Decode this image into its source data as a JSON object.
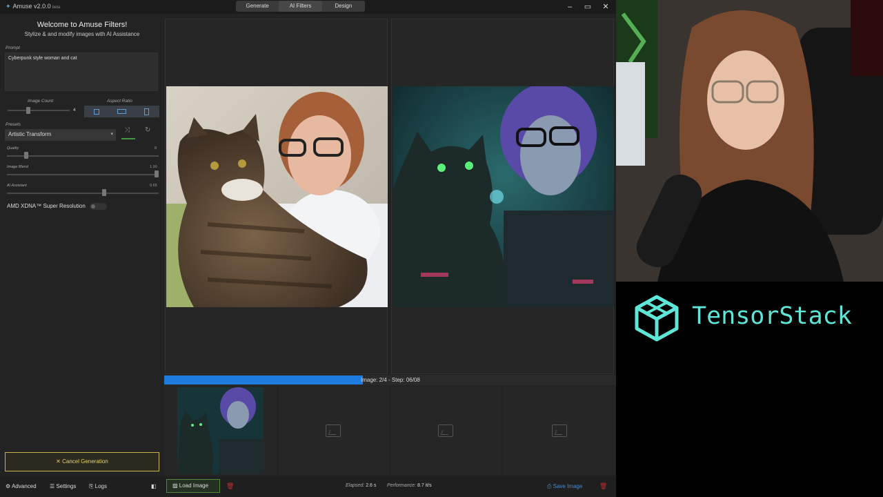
{
  "app": {
    "title": "Amuse v2.0.0",
    "title_suffix": "beta",
    "tabs": [
      "Generate",
      "AI Filters",
      "Design"
    ],
    "active_tab": "AI Filters"
  },
  "left_panel": {
    "welcome_title": "Welcome to Amuse Filters!",
    "welcome_subtitle": "Stylize & and modify images with AI Assistance",
    "prompt_label": "Prompt",
    "prompt_value": "Cyberpunk style woman and cat",
    "image_count_label": "Image Count",
    "image_count_value": "4",
    "aspect_ratio_label": "Aspect Ratio",
    "presets_label": "Presets",
    "preset_value": "Artistic Transform",
    "quality_label": "Quality",
    "quality_value": "8",
    "image_blend_label": "Image Blend",
    "image_blend_value": "1.00",
    "ai_assistant_label": "AI Assistant",
    "ai_assistant_value": "0.65",
    "xdna_label": "AMD XDNA™ Super Resolution",
    "cancel_label": "Cancel Generation"
  },
  "progress": {
    "fraction": 0.44,
    "text": "Image: 2/4 - Step: 06/08"
  },
  "bottom_bar": {
    "advanced": "Advanced",
    "settings": "Settings",
    "logs": "Logs",
    "load_image": "Load Image",
    "elapsed_label": "Elapsed:",
    "elapsed_value": "2.6 s",
    "performance_label": "Performance:",
    "performance_value": "8.7 it/s",
    "save_image": "Save Image"
  },
  "brand": {
    "name": "TensorStack"
  },
  "colors": {
    "accent_blue": "#1c7ce0",
    "cancel_yellow": "#c9b44a",
    "brand_teal": "#5ee6d8"
  }
}
